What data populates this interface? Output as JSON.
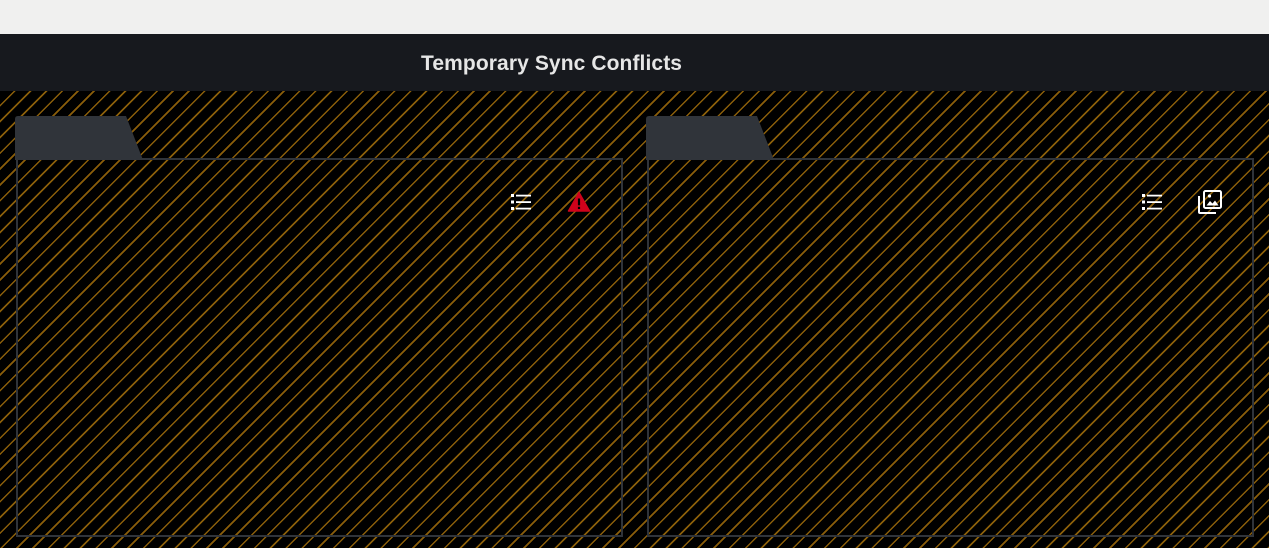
{
  "window": {
    "title": "Temporary Sync Conflicts"
  },
  "colors": {
    "titlebar_bg": "#17191e",
    "workspace_bg": "#000000",
    "stripe": "#8a5e0a",
    "folder_border": "#30343a",
    "warning": "#d0021b",
    "icon": "#ffffff"
  },
  "folders": [
    {
      "id": "left",
      "actions": [
        {
          "icon": "list-icon"
        },
        {
          "icon": "warning-icon"
        }
      ]
    },
    {
      "id": "right",
      "actions": [
        {
          "icon": "list-icon"
        },
        {
          "icon": "image-gallery-icon"
        }
      ]
    }
  ]
}
